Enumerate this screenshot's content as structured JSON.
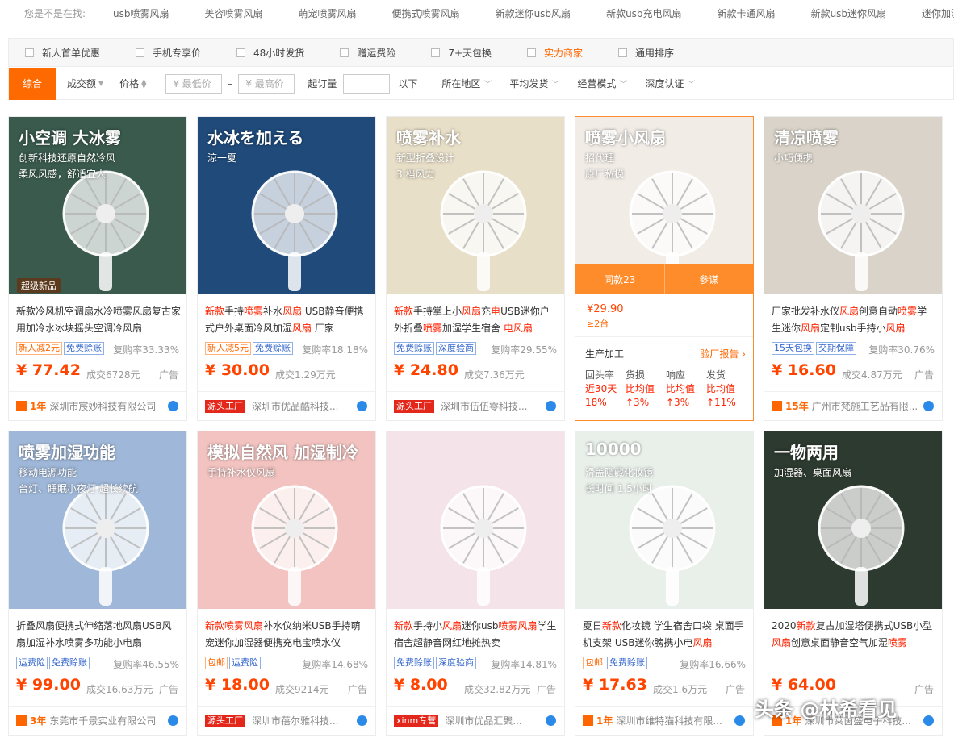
{
  "suggest": {
    "label": "您是不是在找:",
    "keywords": [
      "usb喷雾风扇",
      "美容喷雾风扇",
      "萌宠喷雾风扇",
      "便携式喷雾风扇",
      "新款迷你usb风扇",
      "新款usb充电风扇",
      "新款卡通风扇",
      "新款usb迷你风扇",
      "迷你加湿"
    ]
  },
  "filters": [
    "新人首单优惠",
    "手机专享价",
    "48小时发货",
    "赠运费险",
    "7+天包换",
    "实力商家",
    "通用排序"
  ],
  "sort": {
    "default": "综合",
    "volume": "成交额",
    "price": "价格",
    "min_price_placeholder": "¥ 最低价",
    "max_price_placeholder": "¥ 最高价",
    "dash": "–",
    "moq_label": "起订量",
    "below": "以下",
    "dropdowns": [
      "所在地区",
      "平均发货",
      "经营模式",
      "深度认证"
    ]
  },
  "products": [
    {
      "title_parts": [
        {
          "t": "新款冷风机空调扇水冷喷雾风扇复古家用加冷水冰块摇头空调冷风扇",
          "r": false
        }
      ],
      "badge": "超级新品",
      "tags": [
        {
          "t": "新人减2元",
          "c": "o"
        },
        {
          "t": "免费赊账",
          "c": "b"
        }
      ],
      "rate": "复购率33.33%",
      "price": "¥ 77.42",
      "deal": "成交6728元",
      "ad": "广告",
      "years": "1年",
      "source": "",
      "shop": "深圳市宸妙科技有限公司"
    },
    {
      "title_parts": [
        {
          "t": "新款",
          "r": true
        },
        {
          "t": "手持",
          "r": false
        },
        {
          "t": "喷雾",
          "r": true
        },
        {
          "t": "补水",
          "r": false
        },
        {
          "t": "风扇",
          "r": true
        },
        {
          "t": " USB静音便携式户外桌面冷风加湿",
          "r": false
        },
        {
          "t": "风扇",
          "r": true
        },
        {
          "t": " 厂家",
          "r": false
        }
      ],
      "badge": "",
      "tags": [
        {
          "t": "新人减5元",
          "c": "o"
        },
        {
          "t": "免费赊账",
          "c": "b"
        }
      ],
      "rate": "复购率18.18%",
      "price": "¥ 30.00",
      "deal": "成交1.29万元",
      "ad": "",
      "years": "",
      "source": "源头工厂",
      "shop": "深圳市优品酷科技..."
    },
    {
      "title_parts": [
        {
          "t": "新款",
          "r": true
        },
        {
          "t": "手持掌上小",
          "r": false
        },
        {
          "t": "风扇",
          "r": true
        },
        {
          "t": "充",
          "r": false
        },
        {
          "t": "电",
          "r": true
        },
        {
          "t": "USB迷你户外折叠",
          "r": false
        },
        {
          "t": "喷雾",
          "r": true
        },
        {
          "t": "加湿学生宿舍 ",
          "r": false
        },
        {
          "t": "电风扇",
          "r": true
        }
      ],
      "badge": "",
      "tags": [
        {
          "t": "免费赊账",
          "c": "b"
        },
        {
          "t": "深度验商",
          "c": "b"
        }
      ],
      "rate": "复购率29.55%",
      "price": "¥ 24.80",
      "deal": "成交7.36万元",
      "ad": "",
      "years": "",
      "source": "源头工厂",
      "shop": "深圳市伍伍零科技..."
    },
    {
      "featured": true,
      "same": "同款23",
      "ref": "参谋",
      "price": "¥29.90",
      "min": "≥2台",
      "make": "生产加工",
      "report": "验厂报告",
      "stats": [
        {
          "k": "回头率",
          "v1": "近30天",
          "v2": "18%"
        },
        {
          "k": "货损",
          "v1": "比均值",
          "v2": "↑3%"
        },
        {
          "k": "响应",
          "v1": "比均值",
          "v2": "↑3%"
        },
        {
          "k": "发货",
          "v1": "比均值",
          "v2": "↑11%"
        }
      ]
    },
    {
      "title_parts": [
        {
          "t": "厂家批发补水仪",
          "r": false
        },
        {
          "t": "风扇",
          "r": true
        },
        {
          "t": "创意自动",
          "r": false
        },
        {
          "t": "喷雾",
          "r": true
        },
        {
          "t": "学生迷你",
          "r": false
        },
        {
          "t": "风扇",
          "r": true
        },
        {
          "t": "定制usb手持小",
          "r": false
        },
        {
          "t": "风扇",
          "r": true
        }
      ],
      "badge": "",
      "tags": [
        {
          "t": "15天包换",
          "c": "b"
        },
        {
          "t": "交期保障",
          "c": "b"
        }
      ],
      "rate": "复购率30.76%",
      "price": "¥ 16.60",
      "deal": "成交4.87万元",
      "ad": "广告",
      "years": "15年",
      "source": "",
      "shop": "广州市梵施工艺品有限..."
    },
    {
      "title_parts": [
        {
          "t": "折叠风扇便携式伸缩落地风扇USB风扇加湿补水喷雾多功能小电扇",
          "r": false
        }
      ],
      "badge": "",
      "tags": [
        {
          "t": "运费险",
          "c": "b"
        },
        {
          "t": "免费赊账",
          "c": "b"
        }
      ],
      "rate": "复购率46.55%",
      "price": "¥ 99.00",
      "deal": "成交16.63万元",
      "ad": "广告",
      "years": "3年",
      "source": "",
      "shop": "东莞市千景实业有限公司"
    },
    {
      "title_parts": [
        {
          "t": "新款喷雾风扇",
          "r": true
        },
        {
          "t": "补水仪纳米USB手持萌宠迷你加湿器便携充电宝喷水仪",
          "r": false
        }
      ],
      "badge": "",
      "tags": [
        {
          "t": "包邮",
          "c": "o"
        },
        {
          "t": "运费险",
          "c": "b"
        }
      ],
      "rate": "复购率14.68%",
      "price": "¥ 18.00",
      "deal": "成交9214元",
      "ad": "广告",
      "years": "",
      "source": "源头工厂",
      "shop": "深圳市蓓尔雅科技..."
    },
    {
      "title_parts": [
        {
          "t": "新款",
          "r": true
        },
        {
          "t": "手持小",
          "r": false
        },
        {
          "t": "风扇",
          "r": true
        },
        {
          "t": "迷你usb",
          "r": false
        },
        {
          "t": "喷雾风扇",
          "r": true
        },
        {
          "t": "学生宿舍超静音网红地摊热卖",
          "r": false
        }
      ],
      "badge": "",
      "tags": [
        {
          "t": "免费赊账",
          "c": "b"
        },
        {
          "t": "深度验商",
          "c": "b"
        }
      ],
      "rate": "复购率14.81%",
      "price": "¥ 8.00",
      "deal": "成交32.82万元",
      "ad": "广告",
      "years": "",
      "source": "xinm专营",
      "shop": "深圳市优品汇聚..."
    },
    {
      "title_parts": [
        {
          "t": "夏日",
          "r": false
        },
        {
          "t": "新款",
          "r": true
        },
        {
          "t": "化妆镜 学生宿舍口袋 桌面手机支架 USB迷你膀携小电",
          "r": false
        },
        {
          "t": "风扇",
          "r": true
        }
      ],
      "badge": "",
      "tags": [
        {
          "t": "包邮",
          "c": "o"
        },
        {
          "t": "免费赊账",
          "c": "b"
        }
      ],
      "rate": "复购率16.66%",
      "price": "¥ 17.63",
      "deal": "成交1.6万元",
      "ad": "广告",
      "years": "1年",
      "source": "",
      "shop": "深圳市维特猫科技有限..."
    },
    {
      "title_parts": [
        {
          "t": "2020",
          "r": false
        },
        {
          "t": "新款",
          "r": true
        },
        {
          "t": "复古加湿塔便携式USB小型",
          "r": false
        },
        {
          "t": "风扇",
          "r": true
        },
        {
          "t": "创意桌面静音空气加湿",
          "r": false
        },
        {
          "t": "喷雾",
          "r": true
        }
      ],
      "badge": "",
      "tags": [],
      "rate": "",
      "price": "¥ 64.00",
      "deal": "",
      "ad": "广告",
      "years": "1年",
      "source": "",
      "shop": "深圳市莱茵盛电子科技..."
    }
  ],
  "images": [
    {
      "bg": "#3a5a4e",
      "h1": "小空调 大冰雾",
      "h2": "创新科技还原自然冷风",
      "h3": "柔风风感，舒适宜人"
    },
    {
      "bg": "#1f4a7a",
      "h1": "水冰を加える",
      "h2": "涼一夏",
      "h3": ""
    },
    {
      "bg": "#e8dfc8",
      "h1": "喷雾补水",
      "h2": "新型折叠设计",
      "h3": "3 档风力"
    },
    {
      "bg": "#f1ece6",
      "h1": "喷雾小风扇",
      "h2": "招代理",
      "h3": "原厂私模"
    },
    {
      "bg": "#d9d3c9",
      "h1": "清凉喷雾",
      "h2": "小巧便携",
      "h3": ""
    },
    {
      "bg": "#9fb7d8",
      "h1": "喷雾加湿功能",
      "h2": "移动电源功能",
      "h3": "台灯、睡眠小夜灯 超长续航"
    },
    {
      "bg": "#f2c3c0",
      "h1": "模拟自然风 加湿制冷",
      "h2": "手持补水仪风扇",
      "h3": ""
    },
    {
      "bg": "#f4e4ea",
      "h1": "",
      "h2": "",
      "h3": ""
    },
    {
      "bg": "#e9f0ea",
      "h1": "10000",
      "h2": "滑盖隐藏化妆镜",
      "h3": "长时间 1.5小时"
    },
    {
      "bg": "#2d3a2f",
      "h1": "一物两用",
      "h2": "加湿器、桌面风扇",
      "h3": ""
    }
  ],
  "watermark": "头条 @林希看见"
}
